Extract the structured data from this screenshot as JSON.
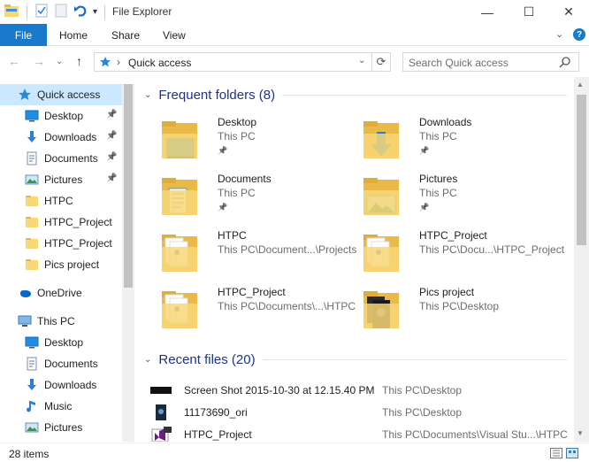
{
  "window": {
    "title": "File Explorer",
    "controls": {
      "minimize": "—",
      "maximize": "☐",
      "close": "✕"
    }
  },
  "ribbon": {
    "tabs": [
      "File",
      "Home",
      "Share",
      "View"
    ],
    "collapse": "⌄",
    "help": "?"
  },
  "address": {
    "back": "←",
    "forward": "→",
    "recent": "⌄",
    "up": "↑",
    "separator": "›",
    "path": "Quick access",
    "dropdown": "⌄",
    "refresh": "⟳",
    "search_placeholder": "Search Quick access"
  },
  "sidebar": {
    "items": [
      {
        "label": "Quick access",
        "icon": "star-icon",
        "pinned": false,
        "selected": true
      },
      {
        "label": "Desktop",
        "icon": "desktop-icon",
        "pinned": true
      },
      {
        "label": "Downloads",
        "icon": "download-icon",
        "pinned": true
      },
      {
        "label": "Documents",
        "icon": "documents-icon",
        "pinned": true
      },
      {
        "label": "Pictures",
        "icon": "pictures-icon",
        "pinned": true
      },
      {
        "label": "HTPC",
        "icon": "folder-icon",
        "pinned": false
      },
      {
        "label": "HTPC_Project",
        "icon": "folder-icon",
        "pinned": false
      },
      {
        "label": "HTPC_Project",
        "icon": "folder-icon",
        "pinned": false
      },
      {
        "label": "Pics project",
        "icon": "folder-icon",
        "pinned": false
      },
      {
        "label": "OneDrive",
        "icon": "cloud-icon",
        "pinned": false
      },
      {
        "label": "This PC",
        "icon": "computer-icon",
        "pinned": false
      },
      {
        "label": "Desktop",
        "icon": "desktop-icon",
        "pinned": false
      },
      {
        "label": "Documents",
        "icon": "documents-icon",
        "pinned": false
      },
      {
        "label": "Downloads",
        "icon": "download-icon",
        "pinned": false
      },
      {
        "label": "Music",
        "icon": "music-icon",
        "pinned": false
      },
      {
        "label": "Pictures",
        "icon": "pictures-icon",
        "pinned": false
      }
    ]
  },
  "frequent": {
    "heading": "Frequent folders (8)",
    "folders": [
      {
        "name": "Desktop",
        "path": "This PC",
        "pinned": true,
        "overlay": "desktop"
      },
      {
        "name": "Downloads",
        "path": "This PC",
        "pinned": true,
        "overlay": "download"
      },
      {
        "name": "Documents",
        "path": "This PC",
        "pinned": true,
        "overlay": "document"
      },
      {
        "name": "Pictures",
        "path": "This PC",
        "pinned": true,
        "overlay": "picture"
      },
      {
        "name": "HTPC",
        "path": "This PC\\Document...\\Projects",
        "pinned": false,
        "overlay": "papers"
      },
      {
        "name": "HTPC_Project",
        "path": "This PC\\Docu...\\HTPC_Project",
        "pinned": false,
        "overlay": "papers"
      },
      {
        "name": "HTPC_Project",
        "path": "This PC\\Documents\\...\\HTPC",
        "pinned": false,
        "overlay": "papers"
      },
      {
        "name": "Pics project",
        "path": "This PC\\Desktop",
        "pinned": false,
        "overlay": "dark"
      }
    ]
  },
  "recent": {
    "heading": "Recent files (20)",
    "files": [
      {
        "name": "Screen Shot 2015-10-30 at 12.15.40 PM",
        "location": "This PC\\Desktop",
        "icon": "image-thumb-icon"
      },
      {
        "name": "11173690_ori",
        "location": "This PC\\Desktop",
        "icon": "photo-thumb-icon"
      },
      {
        "name": "HTPC_Project",
        "location": "This PC\\Documents\\Visual Stu...\\HTPC",
        "icon": "visual-studio-icon"
      }
    ]
  },
  "status": {
    "items_count": "28 items"
  },
  "colors": {
    "accent": "#1979ca",
    "selection": "#cce8ff",
    "folder": "#f8d775",
    "group_heading": "#1e3287"
  }
}
